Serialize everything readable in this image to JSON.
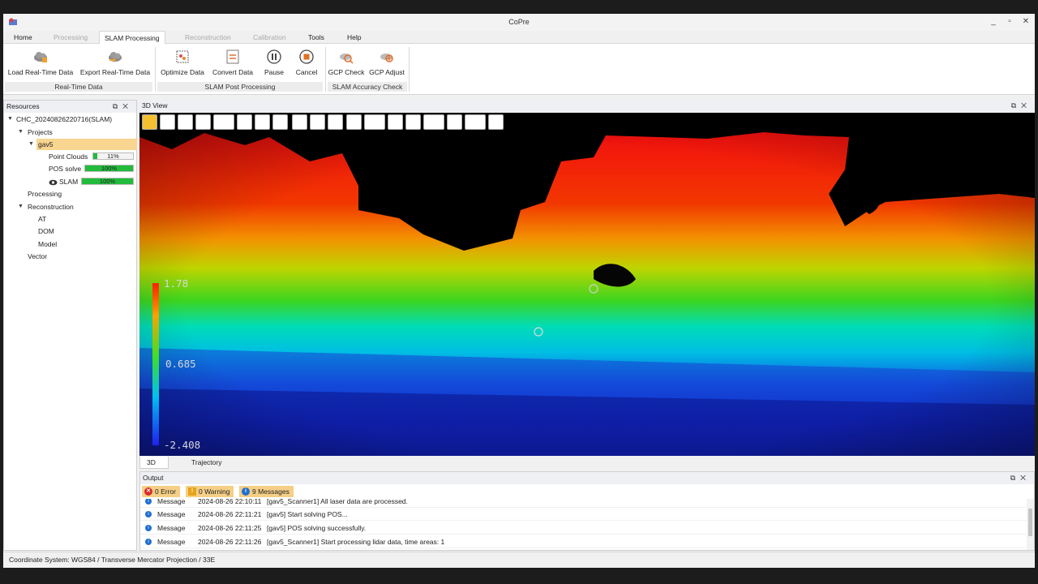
{
  "app": {
    "title": "CoPre"
  },
  "window_controls": {
    "minimize": "_",
    "maximize": "▫",
    "close": "✕"
  },
  "menu_tabs": [
    {
      "label": "Home",
      "state": "normal"
    },
    {
      "label": "Processing",
      "state": "disabled"
    },
    {
      "label": "SLAM Processing",
      "state": "active"
    },
    {
      "label": "Reconstruction",
      "state": "disabled"
    },
    {
      "label": "Calibration",
      "state": "disabled"
    },
    {
      "label": "Tools",
      "state": "normal"
    },
    {
      "label": "Help",
      "state": "normal"
    }
  ],
  "ribbon": {
    "buttons": [
      {
        "label": "Load Real-Time Data",
        "icon": "cloud-upload-icon"
      },
      {
        "label": "Export Real-Time Data",
        "icon": "cloud-export-icon"
      },
      {
        "label": "Optimize Data",
        "icon": "optimize-icon"
      },
      {
        "label": "Convert Data",
        "icon": "convert-icon"
      },
      {
        "label": "Pause",
        "icon": "pause-icon"
      },
      {
        "label": "Cancel",
        "icon": "stop-icon"
      },
      {
        "label": "GCP Check",
        "icon": "gcp-check-icon"
      },
      {
        "label": "GCP Adjust",
        "icon": "gcp-adjust-icon"
      }
    ],
    "groups": [
      "Real-Time Data",
      "SLAM Post Processing",
      "SLAM Accuracy Check"
    ]
  },
  "resources": {
    "title": "Resources",
    "project_root": "CHC_20240826220716(SLAM)",
    "projects_label": "Projects",
    "selected_project": "gav5",
    "items": [
      {
        "label": "Point Clouds",
        "progress_text": "11%",
        "progress": 0.11
      },
      {
        "label": "POS solve",
        "progress_text": "100%",
        "progress": 1.0
      },
      {
        "label": "SLAM",
        "progress_text": "100%",
        "progress": 1.0
      }
    ],
    "processing_label": "Processing",
    "reconstruction_label": "Reconstruction",
    "reconstruction_children": [
      "AT",
      "DOM",
      "Model"
    ],
    "vector_label": "Vector"
  },
  "view": {
    "title": "3D View",
    "tabs": [
      "3D View",
      "Trajectory"
    ],
    "active_tab": "3D View",
    "legend": {
      "max": "1.78",
      "mid": "0.685",
      "min": "-2.408"
    }
  },
  "output": {
    "title": "Output",
    "badges": [
      {
        "label": "0 Error",
        "icon": "error-icon",
        "color": "#d92b2b"
      },
      {
        "label": "0 Warning",
        "icon": "warning-icon",
        "color": "#e8a317"
      },
      {
        "label": "9 Messages",
        "icon": "info-icon",
        "color": "#1f6fd0"
      }
    ],
    "rows": [
      {
        "type": "Message",
        "time": "2024-08-26 22:10:11",
        "text": "[gav5_Scanner1] All laser data are processed."
      },
      {
        "type": "Message",
        "time": "2024-08-26 22:11:21",
        "text": "[gav5] Start solving POS..."
      },
      {
        "type": "Message",
        "time": "2024-08-26 22:11:25",
        "text": "[gav5] POS solving successfully."
      },
      {
        "type": "Message",
        "time": "2024-08-26 22:11:26",
        "text": "[gav5_Scanner1] Start processing lidar data, time areas: 1"
      }
    ]
  },
  "status": {
    "coordinate_system": "Coordinate System: WGS84 / Transverse Mercator Projection / 33E"
  }
}
